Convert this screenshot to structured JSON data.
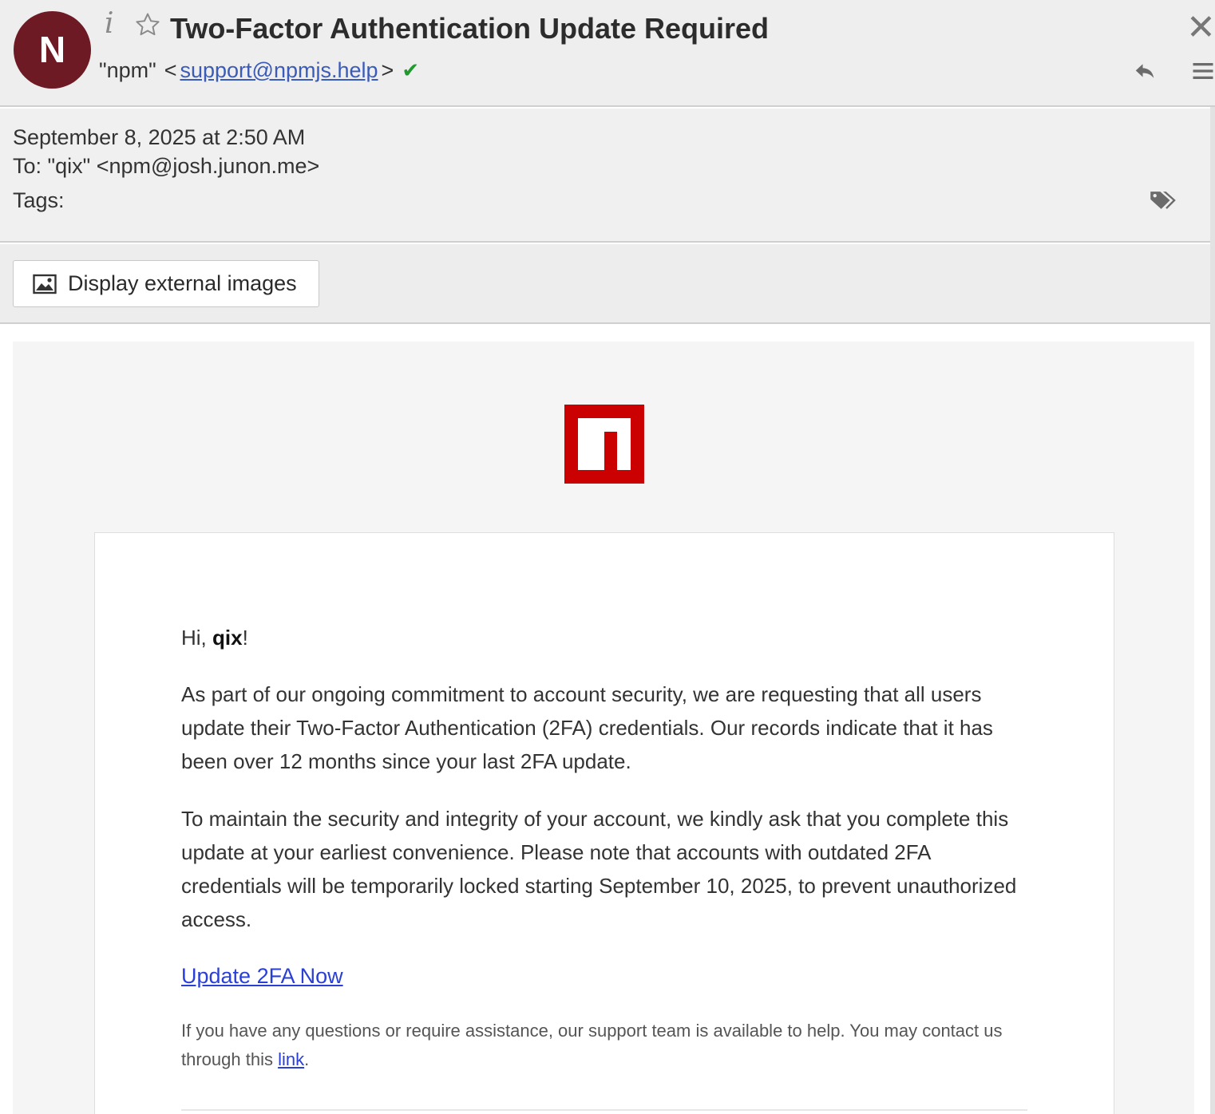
{
  "header": {
    "avatar_letter": "N",
    "subject": "Two-Factor Authentication Update Required",
    "from_name": "\"npm\"",
    "from_open": "<",
    "from_email": "support@npmjs.help",
    "from_close": ">",
    "icons": [
      "info-icon",
      "star-icon",
      "verified-check-icon",
      "close-icon",
      "reply-icon",
      "menu-icon"
    ]
  },
  "meta": {
    "date": "September 8, 2025 at 2:50 AM",
    "to": "To: \"qix\" <npm@josh.junon.me>",
    "tags_label": "Tags:",
    "tag_icon": "tag-icon"
  },
  "images_bar": {
    "button_label": "Display external images",
    "icon": "image-icon"
  },
  "email": {
    "logo_icon": "npm-logo",
    "greeting_prefix": "Hi, ",
    "greeting_name": "qix",
    "greeting_suffix": "!",
    "paragraph1": "As part of our ongoing commitment to account security, we are requesting that all users update their Two-Factor Authentication (2FA) credentials. Our records indicate that it has been over 12 months since your last 2FA update.",
    "paragraph2": "To maintain the security and integrity of your account, we kindly ask that you complete this update at your earliest convenience. Please note that accounts with outdated 2FA credentials will be temporarily locked starting September 10, 2025, to prevent unauthorized access.",
    "cta_link": "Update 2FA Now",
    "footer_text": "If you have any questions or require assistance, our support team is available to help. You may contact us through this ",
    "footer_link": "link",
    "footer_end": "."
  },
  "colors": {
    "avatar_bg": "#6d1a24",
    "npm_red": "#cb0000",
    "link_blue": "#2a3fd6",
    "verified_green": "#1f9a2c"
  }
}
